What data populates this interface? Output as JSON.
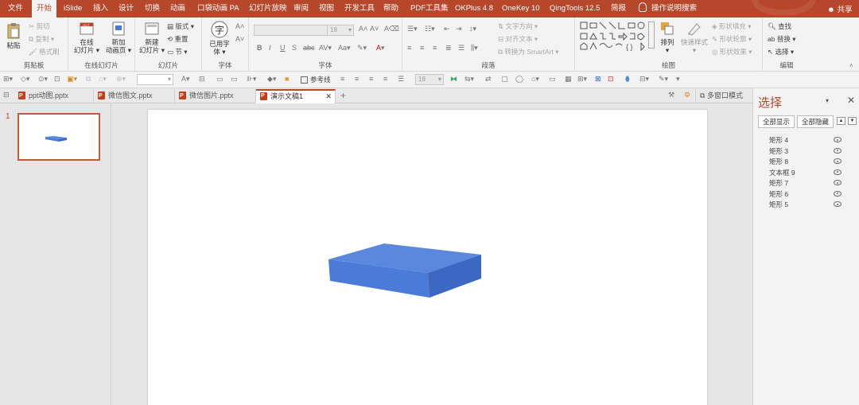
{
  "menu": {
    "tabs": [
      {
        "label": "文件"
      },
      {
        "label": "开始"
      },
      {
        "label": "iSlide"
      },
      {
        "label": "插入"
      },
      {
        "label": "设计"
      },
      {
        "label": "切换"
      },
      {
        "label": "动画"
      },
      {
        "label": "口袋动画 PA"
      },
      {
        "label": "幻灯片放映"
      },
      {
        "label": "审阅"
      },
      {
        "label": "视图"
      },
      {
        "label": "开发工具"
      },
      {
        "label": "帮助"
      },
      {
        "label": "PDF工具集"
      },
      {
        "label": "OKPlus 4.8"
      },
      {
        "label": "OneKey 10"
      },
      {
        "label": "QingTools 12.5"
      },
      {
        "label": "简报"
      }
    ],
    "active_tab": "开始",
    "tell_me": "操作说明搜索",
    "share": "共享"
  },
  "ribbon": {
    "clipboard": {
      "paste": "粘贴",
      "cut": "剪切",
      "copy": "复制",
      "format_painter": "格式刷",
      "label": "剪贴板"
    },
    "slides_online": {
      "online": "在线",
      "online2": "幻灯片",
      "new_anim": "新加",
      "new_anim2": "动画页",
      "label": "在线幻灯片"
    },
    "slides": {
      "new": "新建",
      "new2": "幻灯片",
      "layout": "版式",
      "reset": "重置",
      "section": "节",
      "label": "幻灯片"
    },
    "fonts": {
      "used_fonts": "已用字",
      "used_fonts2": "体",
      "label": "字体"
    },
    "font": {
      "font_name": "",
      "font_size": "18",
      "bold": "B",
      "italic": "I",
      "underline": "U",
      "shadow": "S",
      "strike": "abc",
      "label": "字体"
    },
    "paragraph": {
      "text_direction": "文字方向",
      "align_text": "对齐文本",
      "smartart": "转换为 SmartArt",
      "label": "段落"
    },
    "drawing": {
      "arrange": "排列",
      "quick_styles": "快速样式",
      "fill": "形状填充",
      "outline": "形状轮廓",
      "effects": "形状效果",
      "label": "绘图"
    },
    "editing": {
      "find": "查找",
      "replace": "替换",
      "select": "选择",
      "label": "编辑"
    }
  },
  "qbar": {
    "ref_line": "参考线",
    "size": "18"
  },
  "doc_tabs": [
    {
      "label": "ppt动图.pptx",
      "active": false
    },
    {
      "label": "微信图文.pptx",
      "active": false
    },
    {
      "label": "微信图片.pptx",
      "active": false
    },
    {
      "label": "演示文稿1",
      "active": true
    }
  ],
  "doc_tabs_extra": {
    "multi_window": "多窗口模式"
  },
  "thumbs": {
    "slide_number": "1"
  },
  "selection_pane": {
    "title": "选择",
    "show_all": "全部显示",
    "hide_all": "全部隐藏",
    "objects": [
      {
        "name": "矩形 4"
      },
      {
        "name": "矩形 3"
      },
      {
        "name": "矩形 8"
      },
      {
        "name": "文本框 9"
      },
      {
        "name": "矩形 7"
      },
      {
        "name": "矩形 6"
      },
      {
        "name": "矩形 5"
      }
    ]
  },
  "colors": {
    "accent": "#b7472a",
    "shape_top": "#5a88de",
    "shape_front": "#4a7bd8",
    "shape_side": "#3a68c2"
  }
}
